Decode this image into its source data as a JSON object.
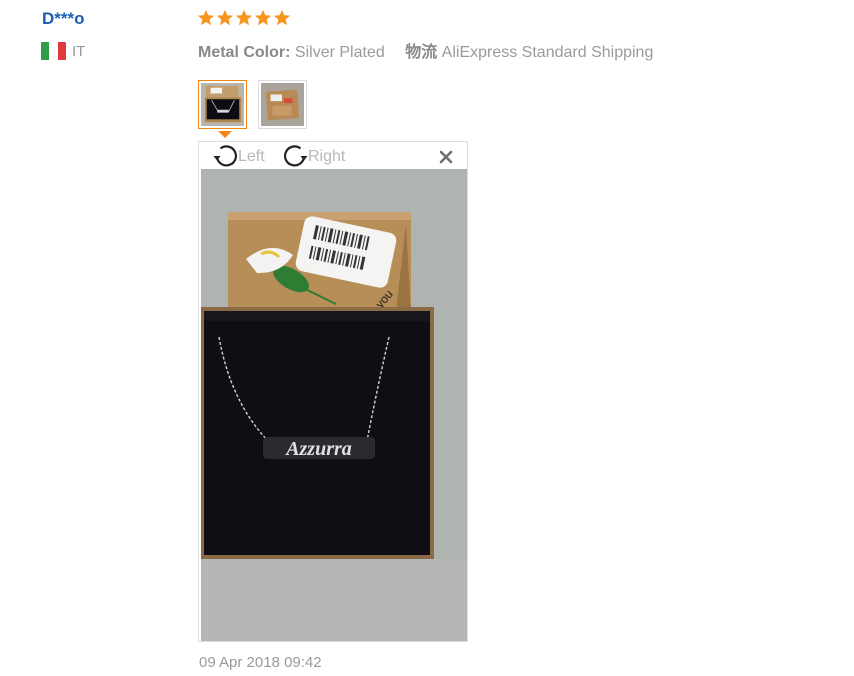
{
  "reviewer": {
    "name": "D***o",
    "country_code": "IT",
    "flag_colors": [
      "#2e9e48",
      "#ffffff",
      "#e03a3e"
    ]
  },
  "rating": {
    "stars": 5,
    "max": 5,
    "color": "#f6941d"
  },
  "sku": {
    "key": "Metal Color:",
    "value": "Silver Plated"
  },
  "shipping": {
    "key": "物流",
    "value": "AliExpress Standard Shipping"
  },
  "thumbnails": [
    {
      "name": "photo-necklace-in-box",
      "active": true
    },
    {
      "name": "photo-package-box",
      "active": false
    }
  ],
  "viewer": {
    "rotate_left_label": "Left",
    "rotate_right_label": "Right",
    "close_icon": "close-icon",
    "photo": {
      "subject": "silver name necklace in black velvet gift box",
      "necklace_text": "Azzurra",
      "box_text": "you"
    }
  },
  "review_date": "09 Apr 2018 09:42",
  "colors": {
    "link_blue": "#1a5fb4",
    "muted_text": "#9a9a9a",
    "active_accent": "#f08518"
  }
}
